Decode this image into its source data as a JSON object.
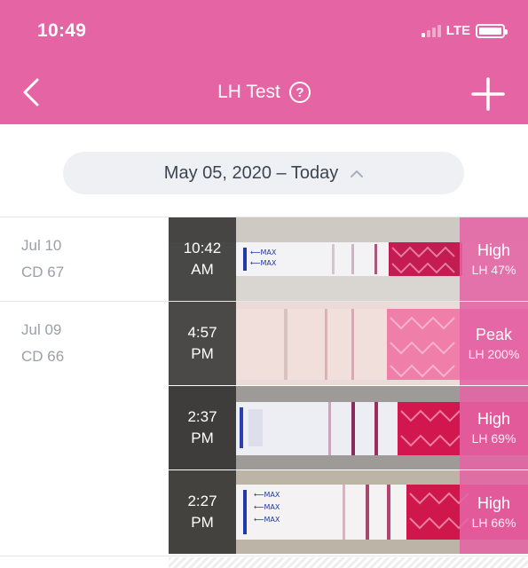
{
  "status_bar": {
    "time": "10:49",
    "network": "LTE"
  },
  "nav": {
    "title": "LH Test",
    "back_icon": "chevron-left-icon",
    "help_icon": "help-icon",
    "add_icon": "plus-icon"
  },
  "date_range": {
    "label": "May 05, 2020 – Today"
  },
  "days": [
    {
      "date": "Jul 10",
      "cycle_day": "CD 67",
      "tests": [
        {
          "time": "10:42",
          "ampm": "AM",
          "level": "High",
          "lh": "LH 47%"
        }
      ]
    },
    {
      "date": "Jul 09",
      "cycle_day": "CD 66",
      "tests": [
        {
          "time": "4:57",
          "ampm": "PM",
          "level": "Peak",
          "lh": "LH 200%"
        },
        {
          "time": "2:37",
          "ampm": "PM",
          "level": "High",
          "lh": "LH 69%"
        },
        {
          "time": "2:27",
          "ampm": "PM",
          "level": "High",
          "lh": "LH 66%"
        }
      ]
    }
  ],
  "colors": {
    "brand_pink": "#e464a4",
    "strip_red": "#d81b4e"
  }
}
